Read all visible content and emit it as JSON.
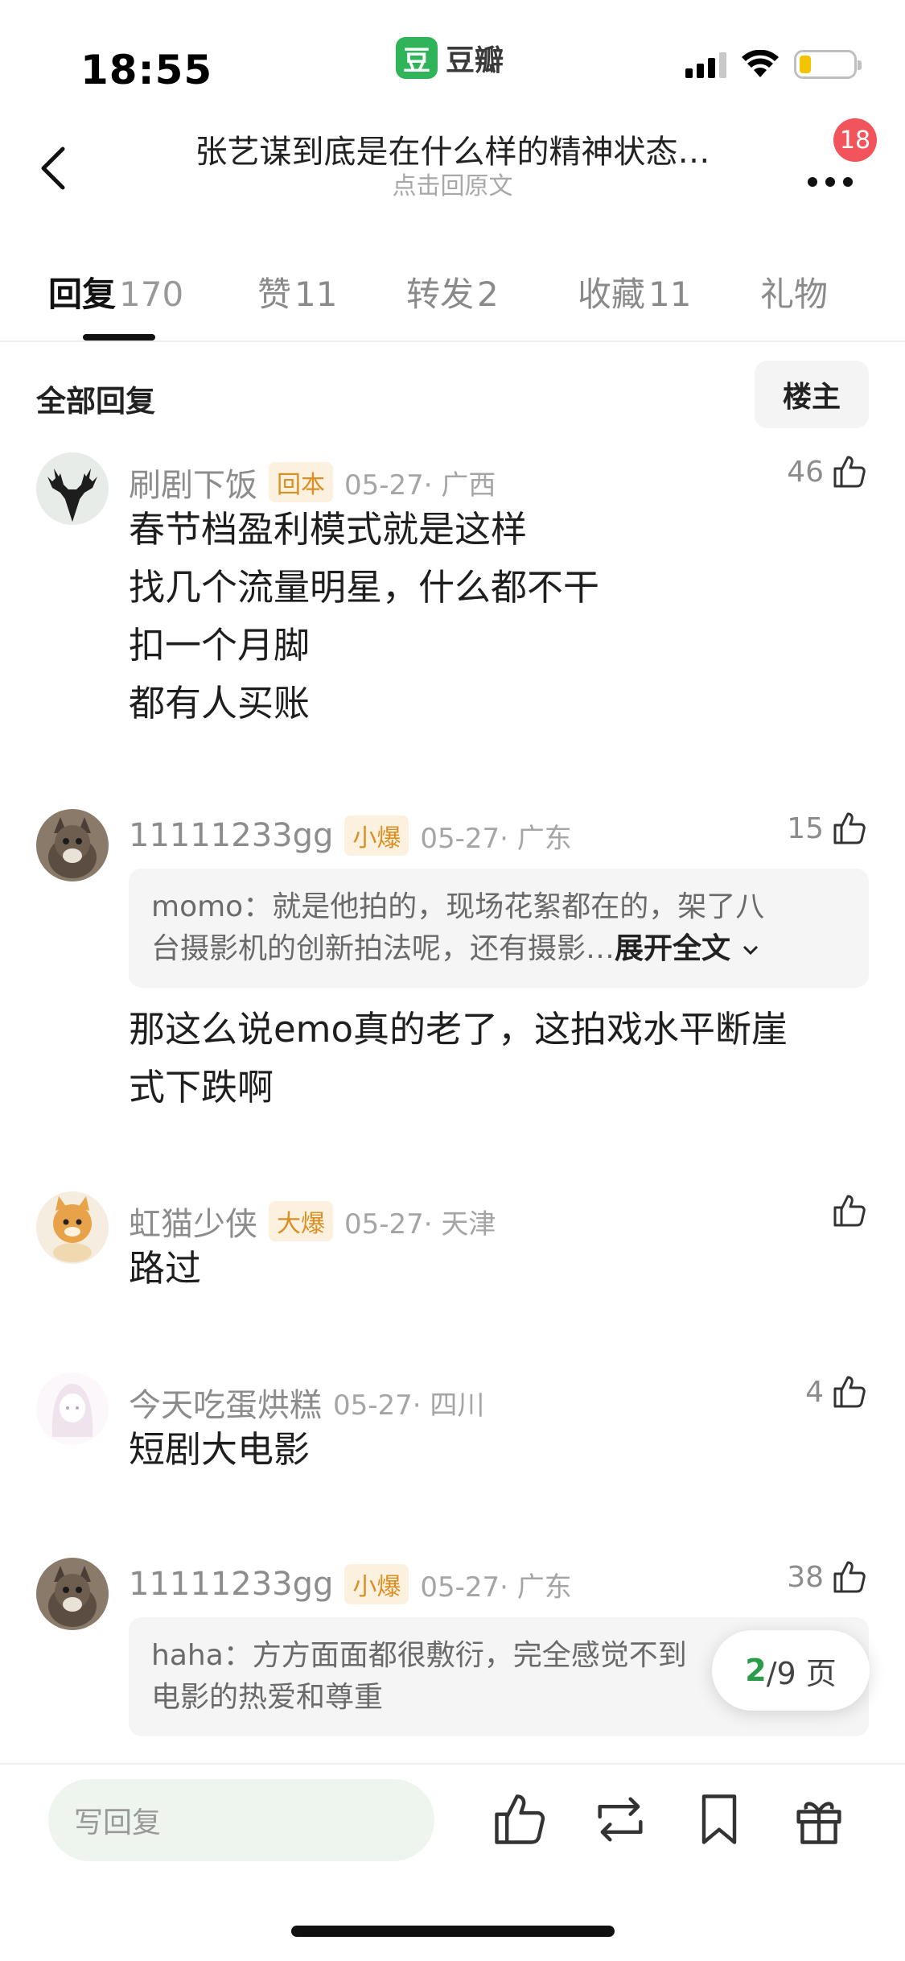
{
  "status_bar": {
    "time": "18:55",
    "app_logo": "豆",
    "app_name": "豆瓣",
    "battery_fraction": 0.22
  },
  "nav": {
    "title": "张艺谋到底是在什么样的精神状态…",
    "subtitle": "点击回原文",
    "notification_count": "18"
  },
  "tabs": [
    {
      "label": "回复",
      "count": "170",
      "active": true
    },
    {
      "label": "赞",
      "count": "11"
    },
    {
      "label": "转发",
      "count": "2"
    },
    {
      "label": "收藏",
      "count": "11"
    },
    {
      "label": "礼物",
      "count": ""
    }
  ],
  "section": {
    "title": "全部回复",
    "filter_label": "楼主"
  },
  "comments": [
    {
      "user": "刷剧下饭",
      "tag": "回本",
      "date": "05-27· 广西",
      "likes": "46",
      "lines": [
        "春节档盈利模式就是这样",
        "找几个流量明星，什么都不干",
        "扣一个月脚",
        "都有人买账"
      ]
    },
    {
      "user": "11111233gg",
      "tag": "小爆",
      "date": "05-27· 广东",
      "likes": "15",
      "quote": {
        "line1": "momo：就是他拍的，现场花絮都在的，架了八",
        "line2": "台摄影机的创新拍法呢，还有摄影…",
        "expand": "展开全文"
      },
      "lines": [
        "那这么说emo真的老了，这拍戏水平断崖",
        "式下跌啊"
      ]
    },
    {
      "user": "虹猫少侠",
      "tag": "大爆",
      "date": "05-27· 天津",
      "likes": "",
      "lines": [
        "路过"
      ]
    },
    {
      "user": "今天吃蛋烘糕",
      "tag": "",
      "date": "05-27· 四川",
      "likes": "4",
      "lines": [
        "短剧大电影"
      ]
    },
    {
      "user": "11111233gg",
      "tag": "小爆",
      "date": "05-27· 广东",
      "likes": "38",
      "quote": {
        "line1": "haha：方方面面都很敷衍，完全感觉不到",
        "line2": "电影的热爱和尊重"
      }
    }
  ],
  "pager": {
    "current": "2",
    "rest": "/9 页"
  },
  "bottom": {
    "reply_placeholder": "写回复"
  }
}
